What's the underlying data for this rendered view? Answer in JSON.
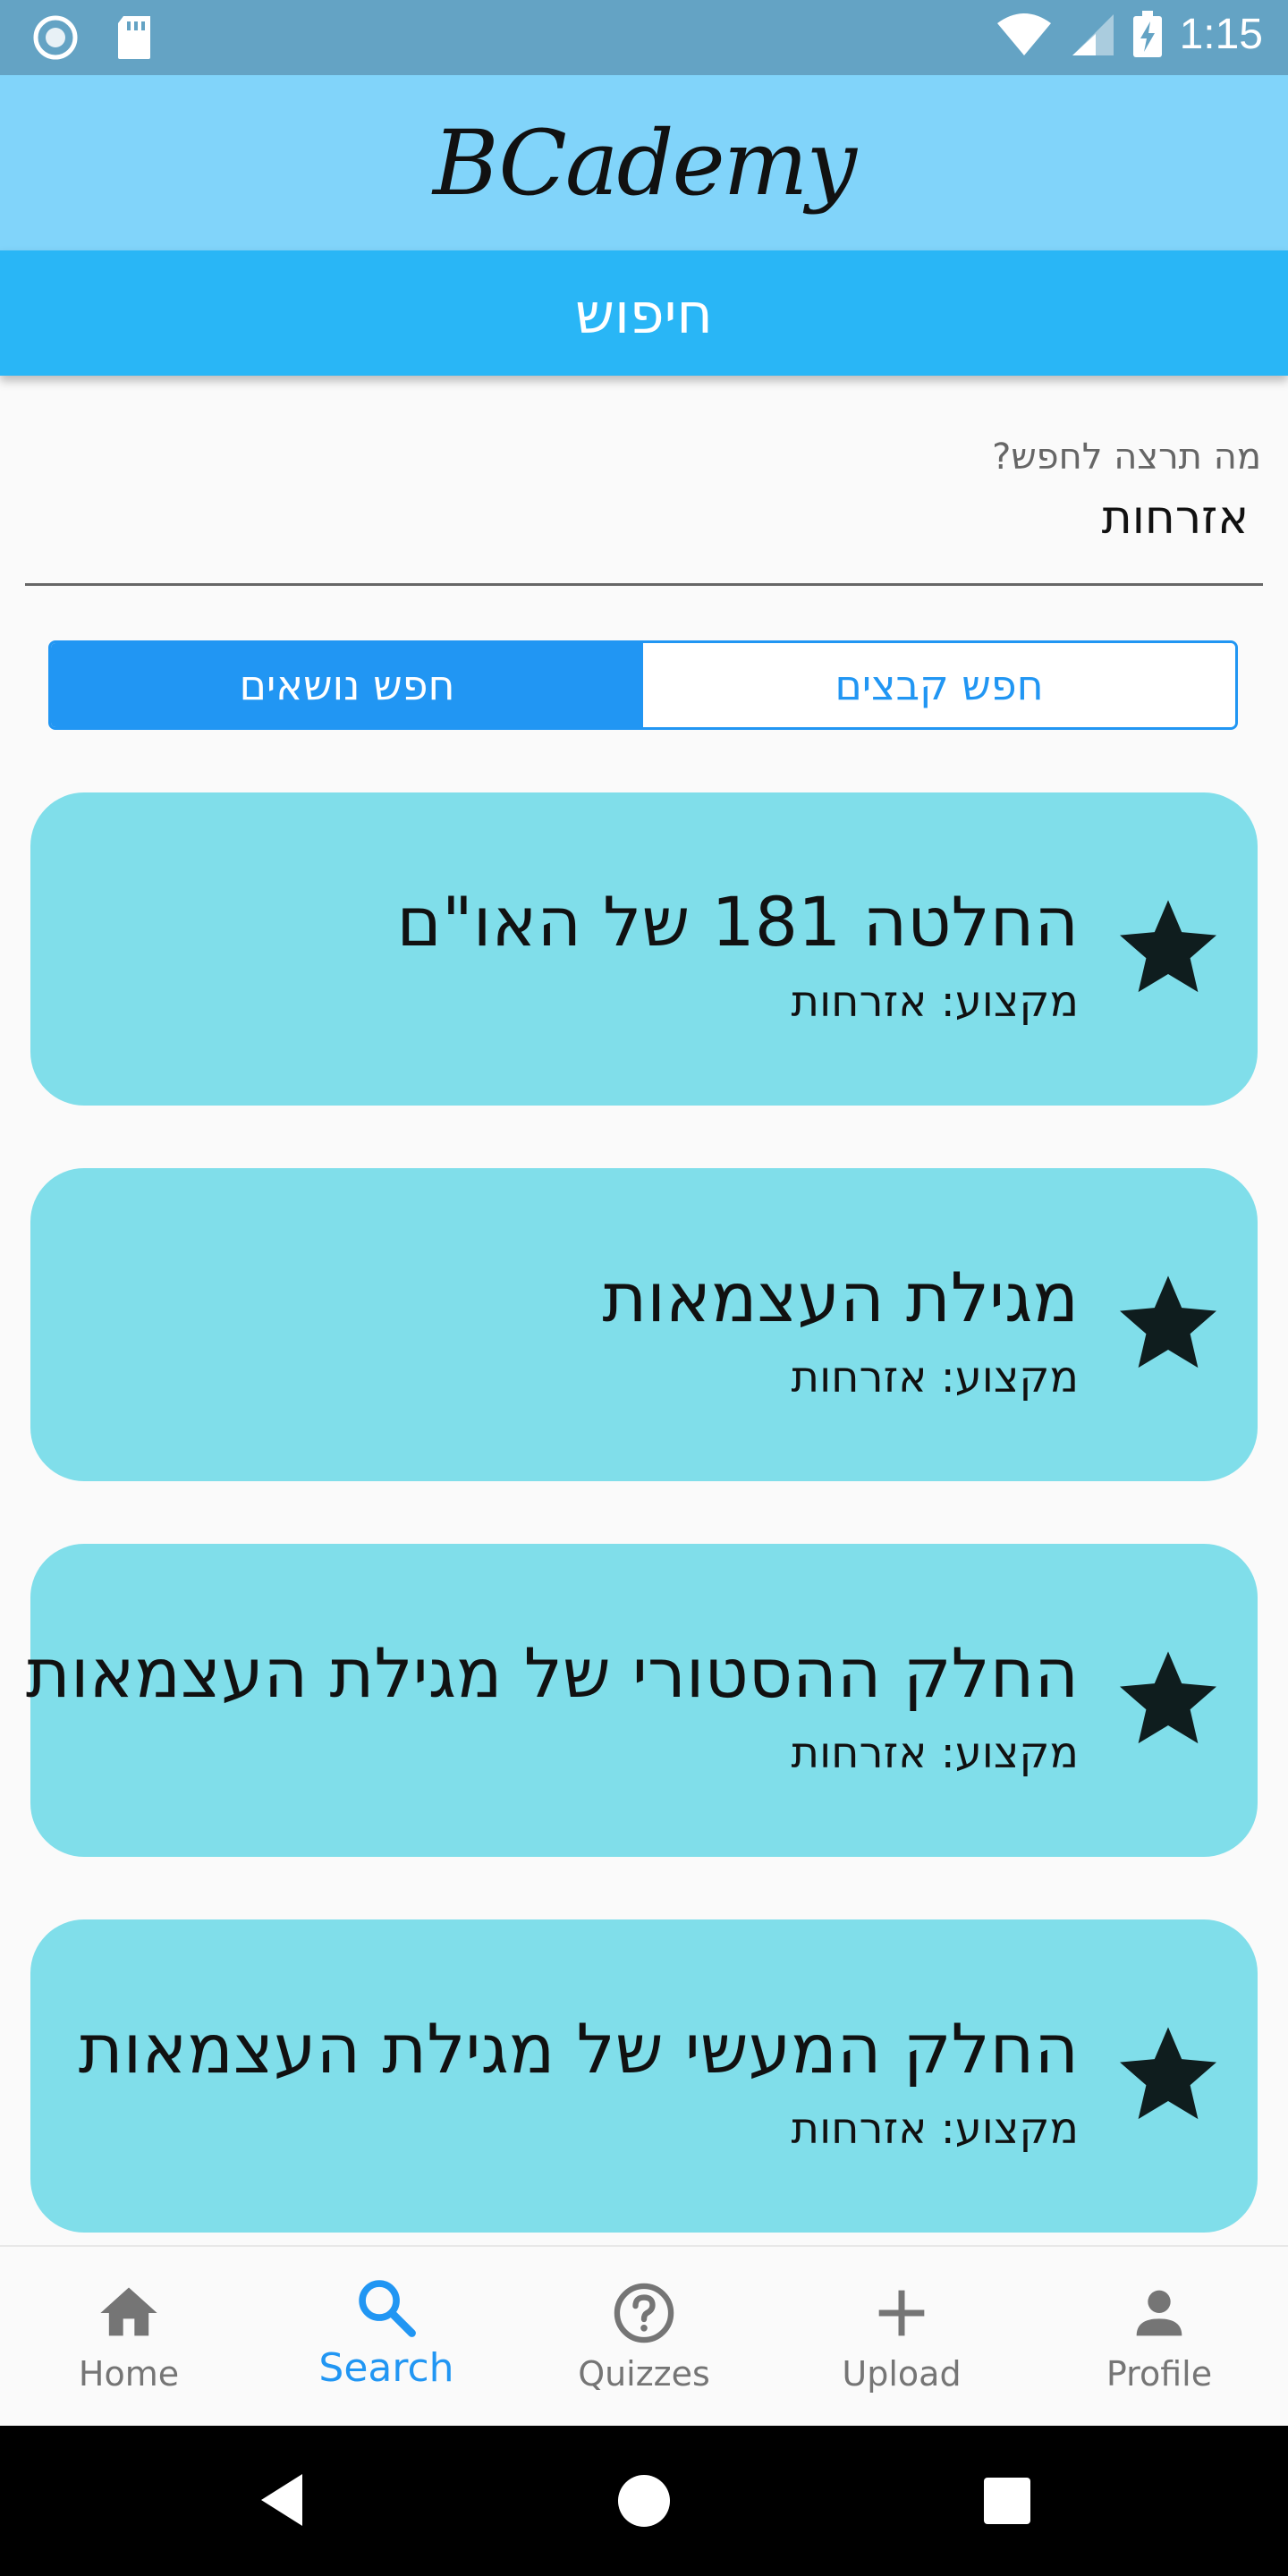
{
  "status_bar": {
    "time": "1:15"
  },
  "header": {
    "logo": "BCademy"
  },
  "title_bar": {
    "title": "חיפוש"
  },
  "search": {
    "label": "מה תרצה לחפש?",
    "value": "אזרחות"
  },
  "toggle": {
    "files_label": "חפש קבצים",
    "topics_label": "חפש נושאים",
    "selected": "חפש נושאים"
  },
  "results": [
    {
      "title": "החלטה 181 של האו\"ם",
      "subject": "מקצוע: אזרחות"
    },
    {
      "title": "מגילת העצמאות",
      "subject": "מקצוע: אזרחות"
    },
    {
      "title": "החלק ההסטורי של מגילת העצמאות",
      "subject": "מקצוע: אזרחות"
    },
    {
      "title": "החלק המעשי של מגילת העצמאות",
      "subject": "מקצוע: אזרחות"
    }
  ],
  "bottom_nav": [
    {
      "label": "Home",
      "icon": "home-icon"
    },
    {
      "label": "Search",
      "icon": "search-icon",
      "active": true
    },
    {
      "label": "Quizzes",
      "icon": "help-circle-icon"
    },
    {
      "label": "Upload",
      "icon": "plus-icon"
    },
    {
      "label": "Profile",
      "icon": "person-icon"
    }
  ],
  "colors": {
    "status_bar": "#64a3c4",
    "header": "#81d4fa",
    "title_bar": "#29b6f6",
    "accent": "#2196f3",
    "card": "#80deea"
  }
}
